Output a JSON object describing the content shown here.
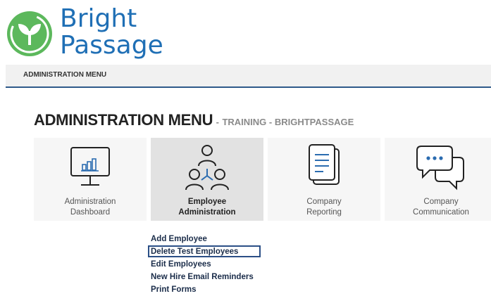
{
  "brand": {
    "line1": "Bright",
    "line2": "Passage",
    "color": "#1f6fb5",
    "logo_color": "#5cb85c"
  },
  "breadcrumb": {
    "label": "ADMINISTRATION MENU"
  },
  "page_title": {
    "main": "ADMINISTRATION MENU",
    "separator": "-",
    "sub": "TRAINING - BRIGHTPASSAGE"
  },
  "tiles": [
    {
      "line1": "Administration",
      "line2": "Dashboard",
      "icon": "monitor-chart-icon",
      "active": false
    },
    {
      "line1": "Employee",
      "line2": "Administration",
      "icon": "people-network-icon",
      "active": true
    },
    {
      "line1": "Company",
      "line2": "Reporting",
      "icon": "documents-icon",
      "active": false
    },
    {
      "line1": "Company",
      "line2": "Communication",
      "icon": "chat-bubbles-icon",
      "active": false
    }
  ],
  "submenu": {
    "items": [
      "Add Employee",
      "Delete Test Employees",
      "Edit Employees",
      "New Hire Email Reminders",
      "Print Forms"
    ],
    "highlighted": "Delete Test Employees"
  }
}
